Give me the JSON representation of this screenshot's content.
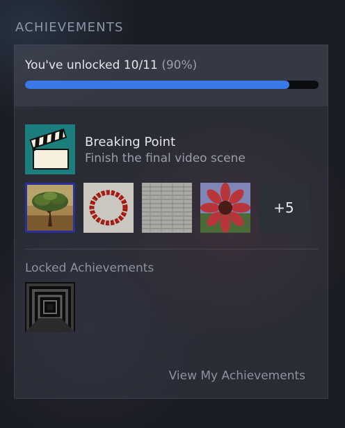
{
  "section_title": "ACHIEVEMENTS",
  "progress": {
    "label": "You've unlocked 10/11",
    "percent_label": "(90%)",
    "unlocked": 10,
    "total": 11,
    "fill_fraction": 0.9
  },
  "featured": {
    "icon": "clapperboard-icon",
    "title": "Breaking Point",
    "description": "Finish the final video scene"
  },
  "unlocked_thumbnails": [
    {
      "name": "tree-painting-icon",
      "selected": true
    },
    {
      "name": "bead-necklace-icon",
      "selected": false
    },
    {
      "name": "brick-wall-icon",
      "selected": false
    },
    {
      "name": "red-flower-icon",
      "selected": false
    }
  ],
  "more": {
    "label": "+5"
  },
  "locked": {
    "label": "Locked Achievements",
    "thumbnails": [
      {
        "name": "dark-corridor-icon"
      }
    ]
  },
  "footer": {
    "view_label": "View My Achievements"
  },
  "colors": {
    "accent": "#3a7ae8",
    "selected_border": "#2b2f9a",
    "icon_bg": "#1c7d7d"
  }
}
